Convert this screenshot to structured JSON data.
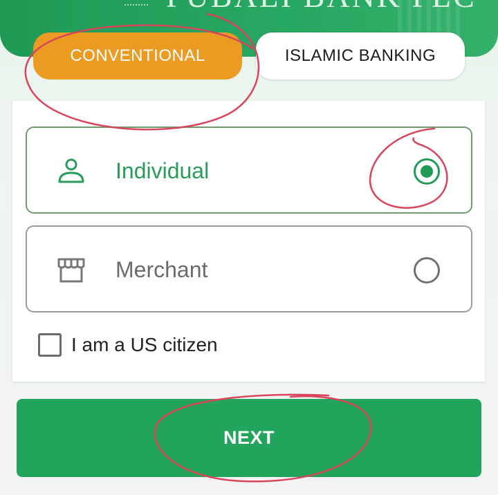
{
  "header": {
    "bank_name": "PUBALI BANK PLC"
  },
  "tabs": [
    {
      "label": "CONVENTIONAL",
      "selected": true
    },
    {
      "label": "ISLAMIC BANKING",
      "selected": false
    }
  ],
  "account_types": [
    {
      "label": "Individual",
      "icon": "person-icon",
      "selected": true
    },
    {
      "label": "Merchant",
      "icon": "store-icon",
      "selected": false
    }
  ],
  "us_citizen": {
    "label": "I am a US citizen",
    "checked": false
  },
  "next_button": {
    "label": "NEXT"
  },
  "colors": {
    "brand_green": "#22a45d",
    "accent_orange": "#eb9a22",
    "annotation_red": "#d9445a"
  }
}
